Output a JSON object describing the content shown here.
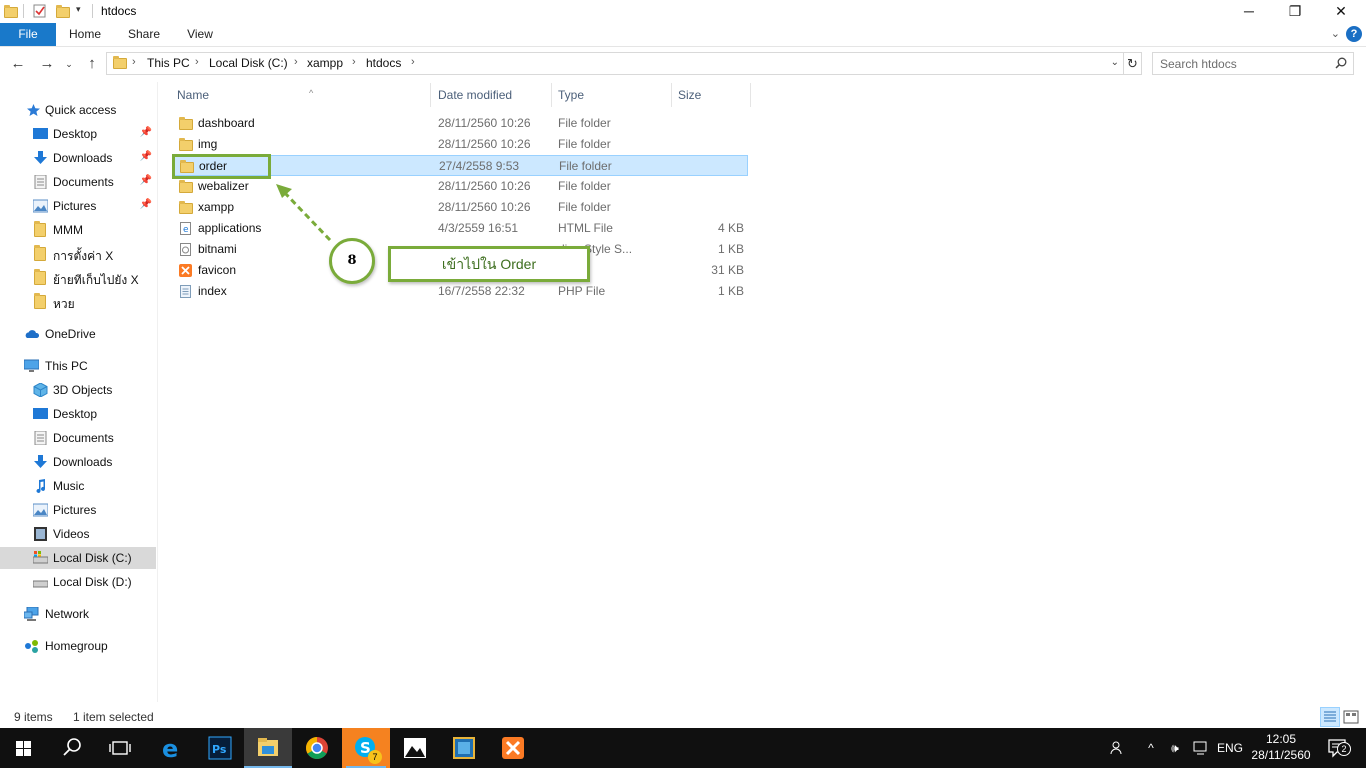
{
  "window": {
    "title": "htdocs",
    "controls": {
      "minimize": "─",
      "maximize": "❐",
      "close": "✕"
    }
  },
  "ribbon": {
    "tabs": [
      "File",
      "Home",
      "Share",
      "View"
    ],
    "help": "?"
  },
  "address": {
    "crumbs": [
      "This PC",
      "Local Disk (C:)",
      "xampp",
      "htdocs"
    ],
    "search_placeholder": "Search htdocs"
  },
  "sidebar": {
    "quick_access": "Quick access",
    "quick_items": [
      {
        "label": "Desktop",
        "icon": "desktop-icon",
        "pinned": true
      },
      {
        "label": "Downloads",
        "icon": "downloads-icon",
        "pinned": true
      },
      {
        "label": "Documents",
        "icon": "documents-icon",
        "pinned": true
      },
      {
        "label": "Pictures",
        "icon": "pictures-icon",
        "pinned": true
      },
      {
        "label": "MMM",
        "icon": "folder-icon",
        "pinned": false
      },
      {
        "label": "การตั้งค่า X",
        "icon": "folder-icon",
        "pinned": false
      },
      {
        "label": "ย้ายทีเก็บไปยัง X",
        "icon": "folder-icon",
        "pinned": false
      },
      {
        "label": "หวย",
        "icon": "folder-icon",
        "pinned": false
      }
    ],
    "onedrive": "OneDrive",
    "this_pc": "This PC",
    "pc_items": [
      {
        "label": "3D Objects",
        "icon": "3d-objects-icon"
      },
      {
        "label": "Desktop",
        "icon": "desktop-icon"
      },
      {
        "label": "Documents",
        "icon": "documents-icon"
      },
      {
        "label": "Downloads",
        "icon": "downloads-icon"
      },
      {
        "label": "Music",
        "icon": "music-icon"
      },
      {
        "label": "Pictures",
        "icon": "pictures-icon"
      },
      {
        "label": "Videos",
        "icon": "videos-icon"
      },
      {
        "label": "Local Disk (C:)",
        "icon": "drive-c-icon",
        "selected": true
      },
      {
        "label": "Local Disk (D:)",
        "icon": "drive-d-icon"
      }
    ],
    "network": "Network",
    "homegroup": "Homegroup"
  },
  "columns": {
    "name": "Name",
    "date": "Date modified",
    "type": "Type",
    "size": "Size"
  },
  "files": [
    {
      "name": "dashboard",
      "date": "28/11/2560 10:26",
      "type": "File folder",
      "size": "",
      "icon": "folder-icon"
    },
    {
      "name": "img",
      "date": "28/11/2560 10:26",
      "type": "File folder",
      "size": "",
      "icon": "folder-icon"
    },
    {
      "name": "order",
      "date": "27/4/2558 9:53",
      "type": "File folder",
      "size": "",
      "icon": "folder-icon",
      "selected": true
    },
    {
      "name": "webalizer",
      "date": "28/11/2560 10:26",
      "type": "File folder",
      "size": "",
      "icon": "folder-icon"
    },
    {
      "name": "xampp",
      "date": "28/11/2560 10:26",
      "type": "File folder",
      "size": "",
      "icon": "folder-icon"
    },
    {
      "name": "applications",
      "date": "4/3/2559 16:51",
      "type": "HTML File",
      "size": "4 KB",
      "icon": "html-file-icon"
    },
    {
      "name": "bitnami",
      "date": "",
      "type": "ding Style S...",
      "size": "1 KB",
      "icon": "css-file-icon"
    },
    {
      "name": "favicon",
      "date": "",
      "type": "",
      "size": "31 KB",
      "icon": "xampp-favicon-icon"
    },
    {
      "name": "index",
      "date": "16/7/2558 22:32",
      "type": "PHP File",
      "size": "1 KB",
      "icon": "php-file-icon"
    }
  ],
  "annotation": {
    "step": "8",
    "text": "เข้าไปใน Order",
    "color": "#7aab3a"
  },
  "status": {
    "items": "9 items",
    "selected": "1 item selected"
  },
  "taskbar": {
    "apps": [
      "start-icon",
      "search-icon",
      "task-view-icon",
      "edge-icon",
      "photoshop-icon",
      "file-explorer-icon",
      "chrome-icon",
      "skype-icon",
      "photos-icon",
      "virtualbox-icon",
      "xampp-icon"
    ],
    "skype_badge": "7",
    "language": "ENG",
    "time": "12:05",
    "date": "28/11/2560",
    "notifications": "2"
  }
}
